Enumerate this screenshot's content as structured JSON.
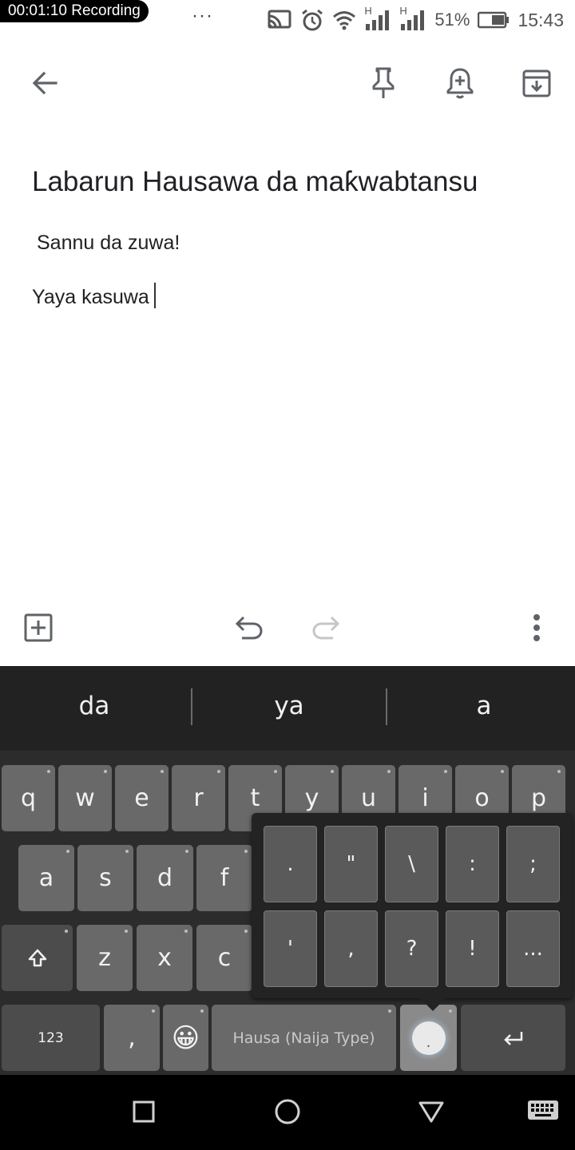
{
  "status_bar": {
    "recording": "00:01:10  Recording",
    "overflow": "···",
    "net1": "H",
    "net2": "H",
    "battery_percent": "51%",
    "time": "15:43",
    "icons": [
      "cast-icon",
      "alarm-icon",
      "wifi-icon",
      "signal-icon",
      "signal-icon",
      "battery-icon"
    ]
  },
  "toolbar": {
    "icons": [
      "back-arrow-icon",
      "pin-icon",
      "reminder-bell-icon",
      "archive-icon"
    ]
  },
  "note": {
    "title": "Labarun Hausawa da maƙwabtansu",
    "line1": "Sannu da zuwa!",
    "line2": "Yaya kasuwa"
  },
  "bottom_toolbar": {
    "icons": [
      "add-box-icon",
      "undo-icon",
      "redo-icon",
      "more-vert-icon"
    ]
  },
  "keyboard": {
    "suggestions": [
      "da",
      "ya",
      "a"
    ],
    "row1": [
      "q",
      "w",
      "e",
      "r",
      "t",
      "y",
      "u",
      "i",
      "o",
      "p"
    ],
    "row2": [
      "a",
      "s",
      "d",
      "f"
    ],
    "row3": [
      "z",
      "x",
      "c"
    ],
    "shift_icon": "shift-icon",
    "numbers_label": "123",
    "comma_label": ",",
    "emoji": "😀",
    "space_label": "Hausa (Naija Type)",
    "period_label": ".",
    "enter_icon": "enter-icon",
    "popup_row1": [
      ".",
      "\"",
      "\\",
      ":",
      ";"
    ],
    "popup_row2": [
      "'",
      ",",
      "?",
      "!",
      "..."
    ]
  },
  "navbar": {
    "icons": [
      "recents-square-icon",
      "home-circle-icon",
      "back-triangle-icon",
      "keyboard-switch-icon"
    ]
  }
}
